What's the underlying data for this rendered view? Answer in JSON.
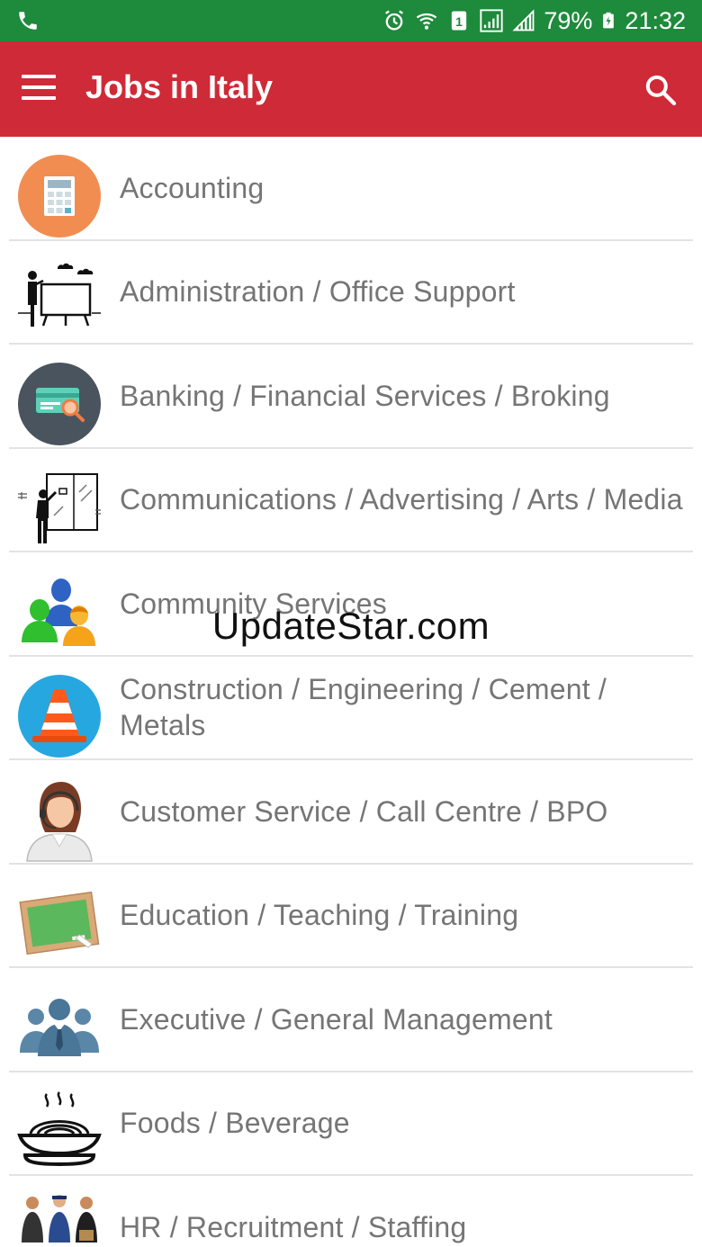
{
  "status_bar": {
    "battery": "79%",
    "time": "21:32",
    "icons": [
      "phone-icon",
      "alarm-icon",
      "wifi-icon",
      "sim-1-icon",
      "signal-icon",
      "signal-icon",
      "battery-charging-icon"
    ]
  },
  "app_bar": {
    "title": "Jobs in Italy",
    "menu_icon": "hamburger-menu-icon",
    "search_icon": "search-icon",
    "color": "#cf2a37"
  },
  "categories": [
    {
      "label": "Accounting",
      "icon": "calculator-icon"
    },
    {
      "label": "Administration / Office Support",
      "icon": "presenter-board-icon"
    },
    {
      "label": "Banking / Financial Services / Broking",
      "icon": "cheque-icon"
    },
    {
      "label": "Communications / Advertising / Arts / Media",
      "icon": "artist-canvas-icon"
    },
    {
      "label": "Community Services",
      "icon": "people-group-icon"
    },
    {
      "label": "Construction / Engineering / Cement / Metals",
      "icon": "traffic-cone-icon"
    },
    {
      "label": "Customer Service / Call Centre / BPO",
      "icon": "headset-agent-icon"
    },
    {
      "label": "Education / Teaching / Training",
      "icon": "chalkboard-icon"
    },
    {
      "label": "Executive / General Management",
      "icon": "executive-team-icon"
    },
    {
      "label": "Foods / Beverage",
      "icon": "food-bowl-icon"
    },
    {
      "label": "HR / Recruitment / Staffing",
      "icon": "staff-group-icon"
    }
  ],
  "watermark": "UpdateStar.com"
}
